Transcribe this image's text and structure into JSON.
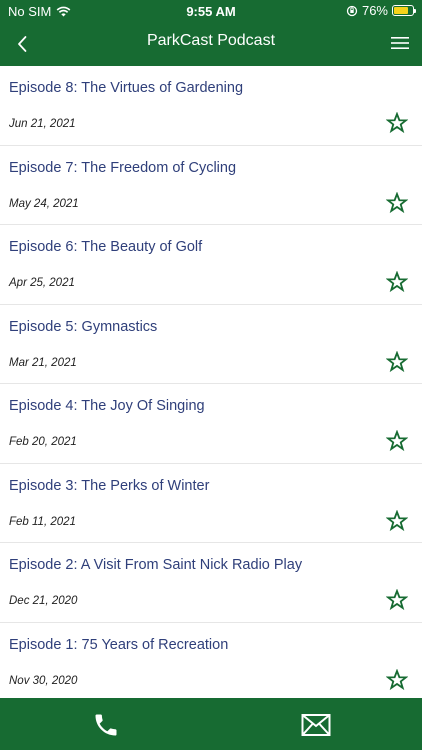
{
  "status": {
    "carrier": "No SIM",
    "time": "9:55 AM",
    "battery": "76%",
    "battery_level": 0.76
  },
  "nav": {
    "title": "ParkCast Podcast",
    "back_icon": "chevron-left-icon",
    "menu_icon": "hamburger-menu-icon"
  },
  "episodes": [
    {
      "title": "Episode 8: The Virtues of Gardening",
      "date": "Jun 21, 2021"
    },
    {
      "title": "Episode 7: The Freedom of Cycling",
      "date": "May 24, 2021"
    },
    {
      "title": "Episode 6: The Beauty of Golf",
      "date": "Apr 25, 2021"
    },
    {
      "title": "Episode 5: Gymnastics",
      "date": "Mar 21, 2021"
    },
    {
      "title": "Episode 4: The Joy Of Singing",
      "date": "Feb 20, 2021"
    },
    {
      "title": "Episode 3: The Perks of Winter",
      "date": "Feb 11, 2021"
    },
    {
      "title": "Episode 2: A Visit From Saint Nick Radio Play",
      "date": "Dec 21, 2020"
    },
    {
      "title": "Episode 1: 75 Years of Recreation",
      "date": "Nov 30, 2020"
    }
  ],
  "bottom_bar": {
    "phone_icon": "phone-icon",
    "mail_icon": "mail-icon"
  },
  "colors": {
    "brand_green": "#176b32",
    "title_blue": "#2f3f7a",
    "star_green": "#176b32",
    "battery_yellow": "#f5d31b"
  }
}
